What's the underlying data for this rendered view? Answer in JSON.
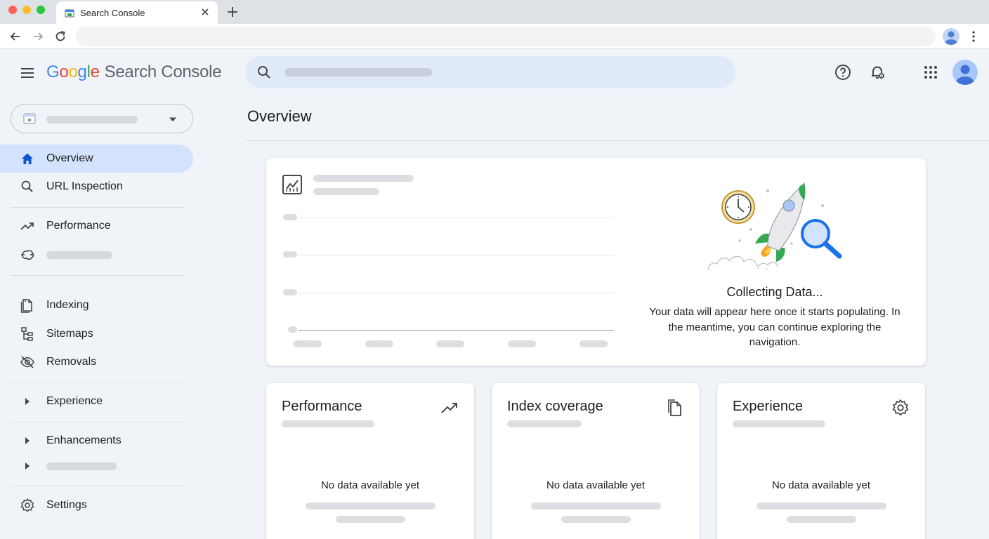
{
  "browser": {
    "tab_title": "Search Console",
    "new_tab_label": "+"
  },
  "header": {
    "logo_letters": [
      "G",
      "o",
      "o",
      "g",
      "l",
      "e"
    ],
    "product_name": "Search Console"
  },
  "sidebar": {
    "items": [
      {
        "label": "Overview",
        "icon": "home-icon",
        "active": true
      },
      {
        "label": "URL Inspection",
        "icon": "search-icon"
      },
      {
        "label": "Performance",
        "icon": "trending-up-icon"
      },
      {
        "label": "",
        "icon": "discover-icon"
      },
      {
        "label": "Indexing",
        "icon": "pages-icon"
      },
      {
        "label": "Sitemaps",
        "icon": "sitemap-icon"
      },
      {
        "label": "Removals",
        "icon": "visibility-off-icon"
      },
      {
        "label": "Experience",
        "icon": "caret-right-icon"
      },
      {
        "label": "Enhancements",
        "icon": "caret-right-icon"
      },
      {
        "label": "",
        "icon": "caret-right-icon"
      },
      {
        "label": "Settings",
        "icon": "gear-icon"
      }
    ]
  },
  "main": {
    "title": "Overview",
    "collecting": {
      "title": "Collecting Data...",
      "text": "Your data will appear here once it starts populating. In the meantime, you can continue exploring the navigation."
    },
    "cards": [
      {
        "title": "Performance",
        "icon": "trending-up-icon",
        "empty_text": "No data available yet"
      },
      {
        "title": "Index coverage",
        "icon": "pages-icon",
        "empty_text": "No data available yet"
      },
      {
        "title": "Experience",
        "icon": "gear-icon",
        "empty_text": "No data available yet"
      }
    ]
  },
  "colors": {
    "active_nav_bg": "#d3e3fd",
    "search_bg": "#e1eaf8",
    "page_bg": "#f0f4f9",
    "accent_blue": "#1a73e8"
  }
}
